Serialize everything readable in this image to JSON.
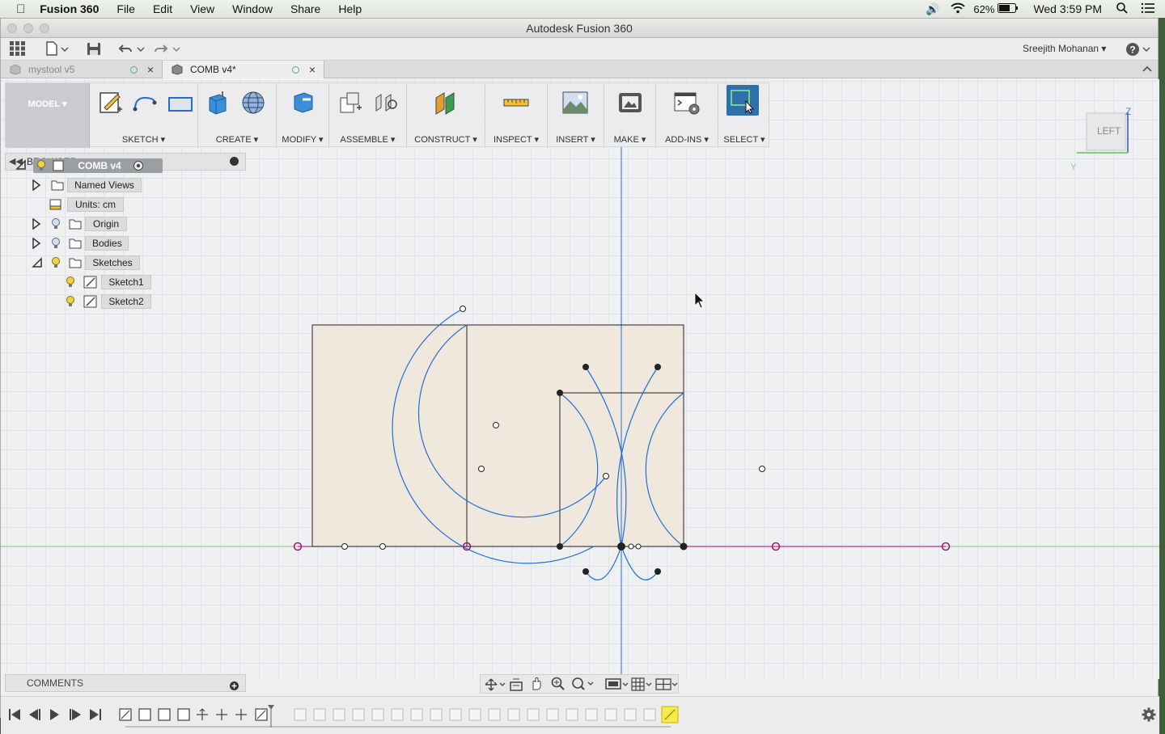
{
  "os_menubar": {
    "app_name": "Fusion 360",
    "items": [
      "File",
      "Edit",
      "View",
      "Window",
      "Share",
      "Help"
    ],
    "battery": "62%",
    "clock": "Wed 3:59 PM"
  },
  "window": {
    "title": "Autodesk Fusion 360"
  },
  "account": {
    "user": "Sreejith Mohanan ▾"
  },
  "doc_tabs": [
    {
      "label": "mystool v5",
      "active": false
    },
    {
      "label": "COMB v4*",
      "active": true
    }
  ],
  "toolbar": {
    "workspace": "MODEL ▾",
    "groups": [
      "SKETCH ▾",
      "CREATE ▾",
      "MODIFY ▾",
      "ASSEMBLE ▾",
      "CONSTRUCT ▾",
      "INSPECT ▾",
      "INSERT ▾",
      "MAKE ▾",
      "ADD-INS ▾",
      "SELECT ▾"
    ]
  },
  "browser": {
    "title": "BROWSER",
    "root": "COMB v4",
    "nodes": [
      "Named Views",
      "Units: cm",
      "Origin",
      "Bodies",
      "Sketches",
      "Sketch1",
      "Sketch2"
    ]
  },
  "viewcube": {
    "face": "LEFT",
    "axis_z": "Z",
    "axis_y": "Y"
  },
  "comments": {
    "title": "COMMENTS"
  },
  "colors": {
    "sketch_curve": "#1f6fd6",
    "sketch_fill": "#efe5da",
    "axis_green": "#7bd27b",
    "constraint": "#a0166f",
    "select_active": "#2f6faa"
  }
}
